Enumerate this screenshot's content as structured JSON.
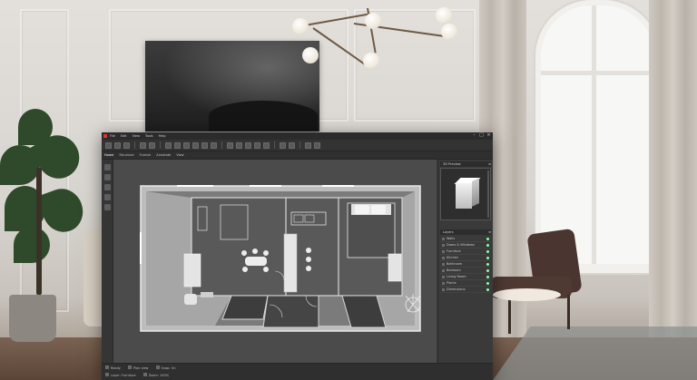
{
  "app": {
    "menu": [
      "File",
      "Edit",
      "View",
      "Tools",
      "Help"
    ]
  },
  "tabs": [
    {
      "label": "Home",
      "active": true
    },
    {
      "label": "Structure"
    },
    {
      "label": "Furnish"
    },
    {
      "label": "Annotate"
    },
    {
      "label": "View"
    }
  ],
  "right_panel": {
    "preview_title": "3D Preview",
    "layers_title": "Layers",
    "layers": [
      {
        "label": "Walls"
      },
      {
        "label": "Doors & Windows"
      },
      {
        "label": "Furniture"
      },
      {
        "label": "Kitchen"
      },
      {
        "label": "Bathroom"
      },
      {
        "label": "Bedroom"
      },
      {
        "label": "Living Room"
      },
      {
        "label": "Plants"
      },
      {
        "label": "Dimensions"
      }
    ]
  },
  "status": {
    "row1": [
      "Ready",
      "Plan view",
      "Snap: On"
    ],
    "row2": [
      "Layer: Furniture",
      "Zoom: 100%"
    ]
  },
  "colors": {
    "app_bg": "#3c3c3c",
    "viewport": "#4b4b4b",
    "wall_fill": "#bdbdbd",
    "logo": "#dd3333"
  }
}
